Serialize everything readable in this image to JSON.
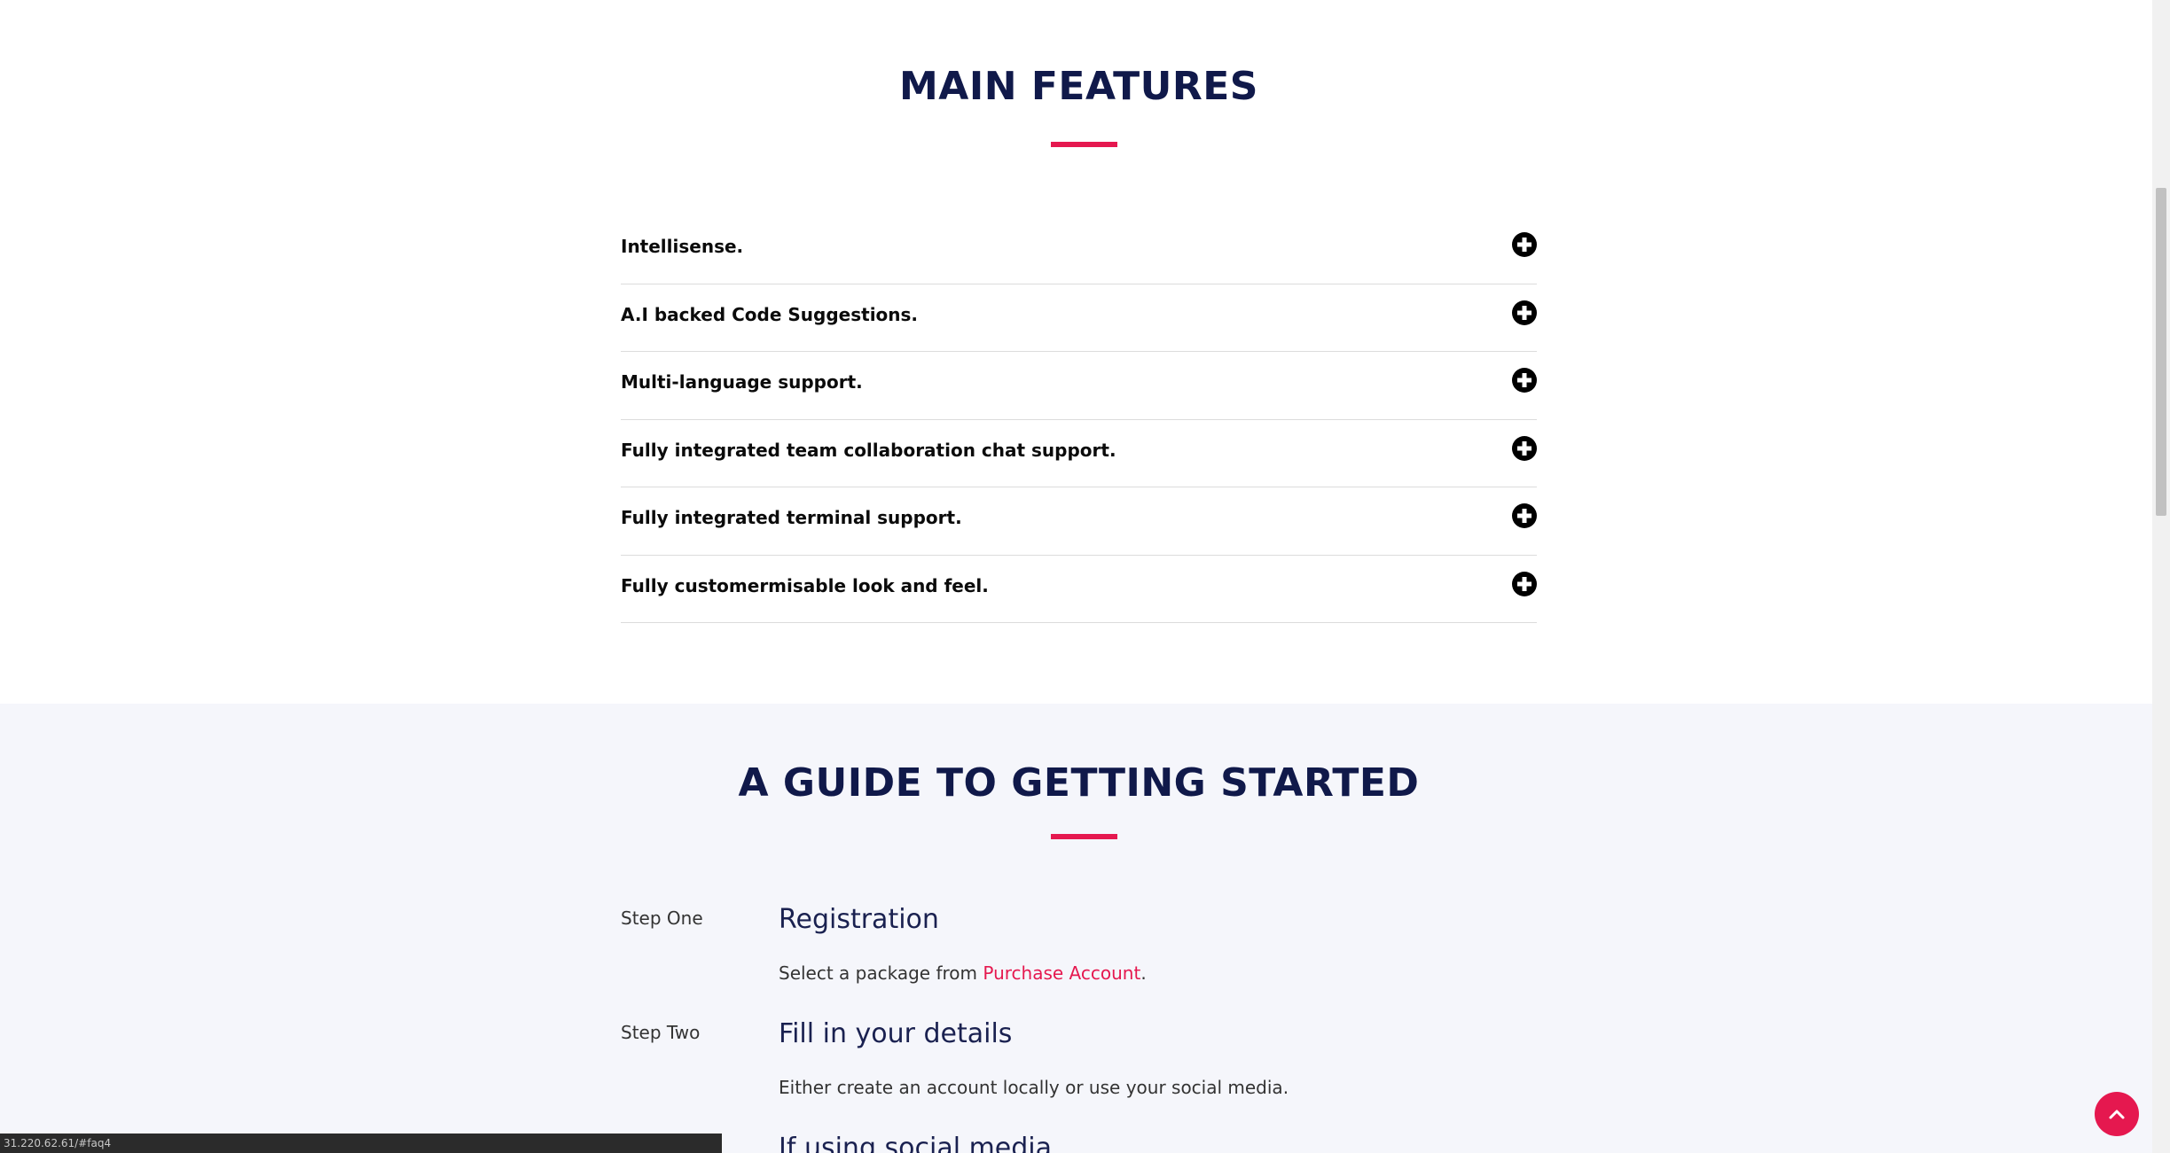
{
  "features": {
    "title": "MAIN FEATURES",
    "items": [
      {
        "label": "Intellisense."
      },
      {
        "label": "A.I backed Code Suggestions."
      },
      {
        "label": "Multi-language support."
      },
      {
        "label": "Fully integrated team collaboration chat support."
      },
      {
        "label": "Fully integrated terminal support."
      },
      {
        "label": "Fully customermisable look and feel."
      }
    ]
  },
  "guide": {
    "title": "A GUIDE TO GETTING STARTED",
    "steps": [
      {
        "label": "Step One",
        "title": "Registration",
        "text_before": "Select a package from ",
        "link": "Purchase Account",
        "text_after": "."
      },
      {
        "label": "Step Two",
        "title": "Fill in your details",
        "text": "Either create an account locally or use your social media."
      },
      {
        "title": "If using social media"
      }
    ]
  },
  "status_bar": {
    "url": "31.220.62.61/#faq4"
  },
  "icons": {
    "expand": "plus-circle-icon",
    "back_to_top": "chevron-up-icon"
  },
  "colors": {
    "accent": "#e5184f",
    "heading": "#10194a",
    "guide_background": "#f5f6fb"
  }
}
